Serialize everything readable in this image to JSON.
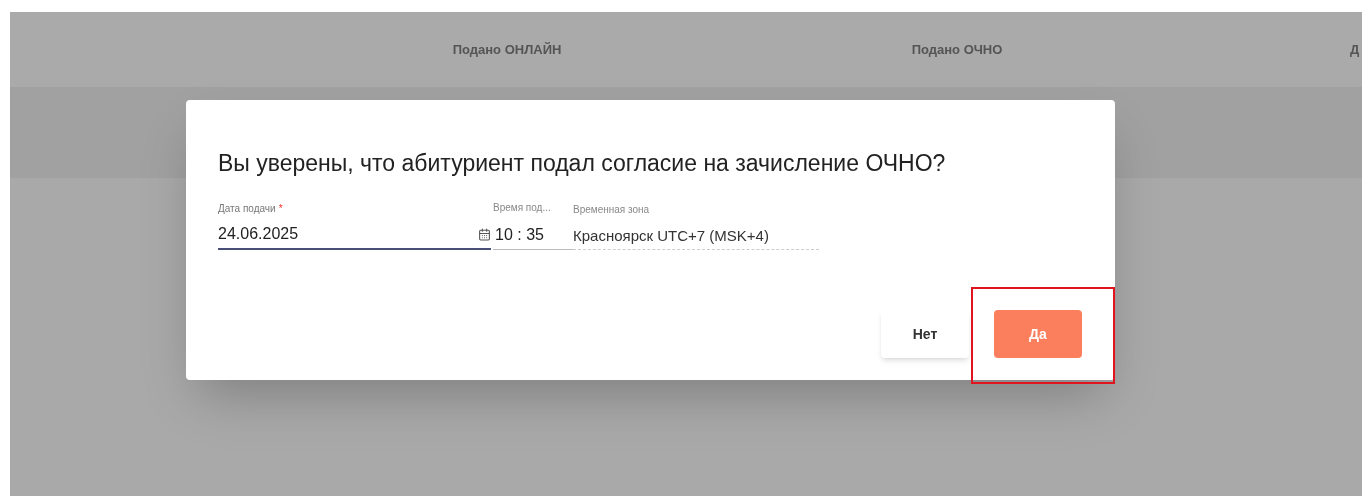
{
  "table_header": {
    "columns": [
      "Подано ОНЛАЙН",
      "Подано ОЧНО",
      "Д"
    ]
  },
  "dialog": {
    "title": "Вы уверены, что абитуриент подал согласие на зачисление ОЧНО?",
    "date_field": {
      "label": "Дата подачи",
      "required_mark": "*",
      "value": "24.06.2025",
      "focused": true
    },
    "time_field": {
      "label": "Время под...",
      "value": "10 : 35"
    },
    "timezone_field": {
      "label": "Временная зона",
      "value": "Красноярск UTC+7 (MSK+4)"
    },
    "buttons": [
      {
        "label": "Нет",
        "kind": "secondary"
      },
      {
        "label": "Да",
        "kind": "primary",
        "highlighted": true
      }
    ]
  }
}
